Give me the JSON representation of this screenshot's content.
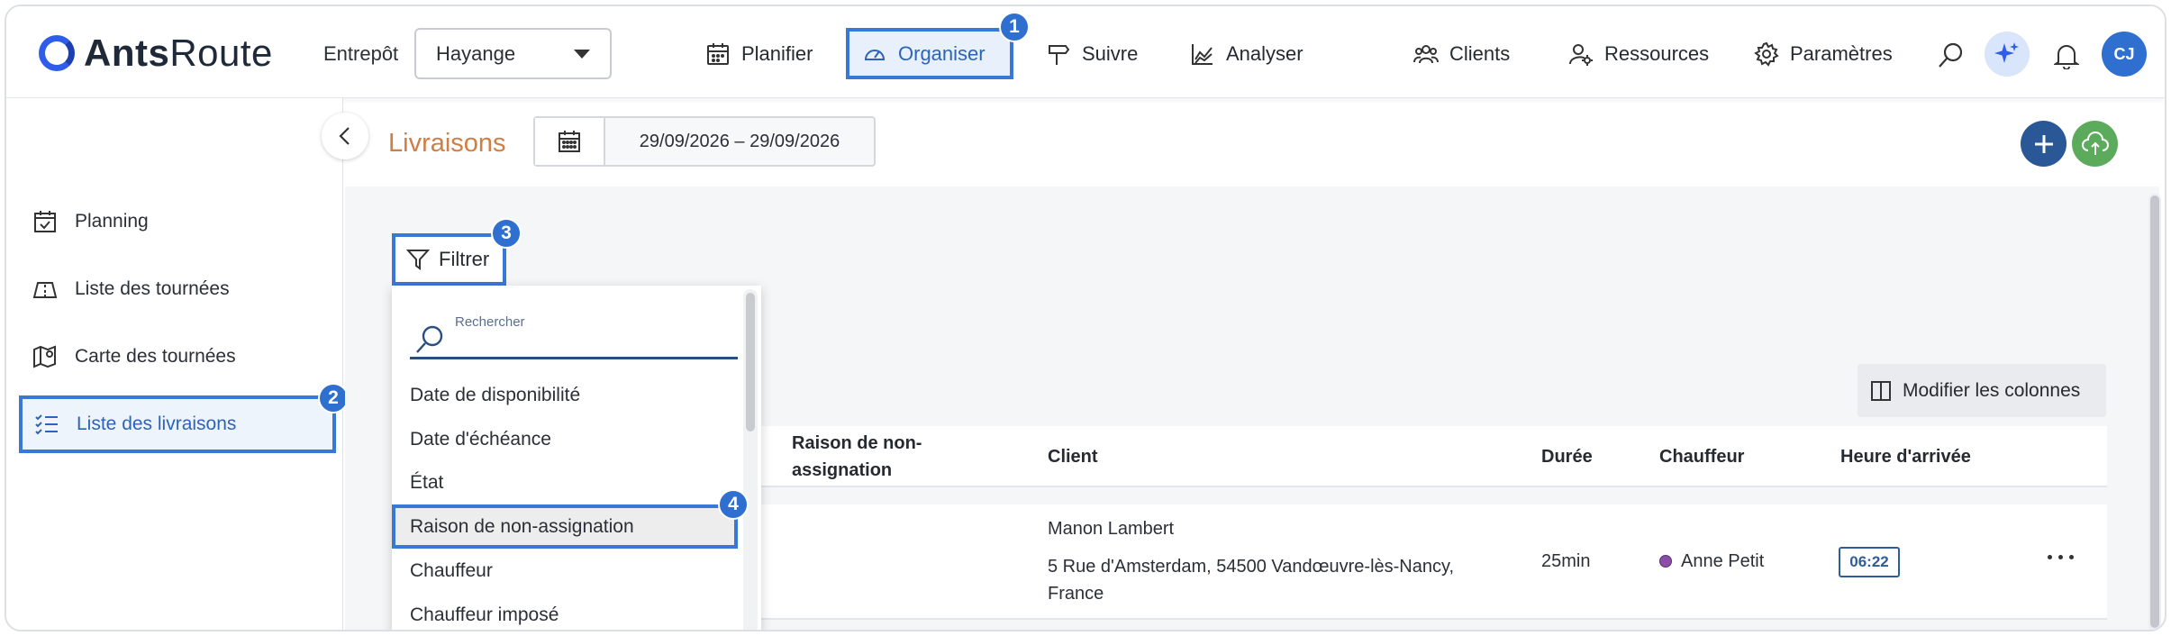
{
  "app": {
    "logo_bold": "Ants",
    "logo_light": "Route"
  },
  "topbar": {
    "warehouse_label": "Entrepôt",
    "warehouse_value": "Hayange",
    "nav": [
      {
        "label": "Planifier",
        "icon": "calendar-icon"
      },
      {
        "label": "Organiser",
        "icon": "gauge-icon",
        "active": true,
        "badge": "1"
      },
      {
        "label": "Suivre",
        "icon": "signpost-icon"
      },
      {
        "label": "Analyser",
        "icon": "chart-icon"
      },
      {
        "label": "Clients",
        "icon": "users-icon"
      },
      {
        "label": "Ressources",
        "icon": "user-gear-icon"
      },
      {
        "label": "Paramètres",
        "icon": "gear-icon"
      }
    ],
    "avatar_initials": "CJ"
  },
  "sidebar": {
    "items": [
      {
        "label": "Planning",
        "icon": "calendar-check-icon"
      },
      {
        "label": "Liste des tournées",
        "icon": "route-list-icon"
      },
      {
        "label": "Carte des tournées",
        "icon": "map-pin-icon"
      },
      {
        "label": "Liste des livraisons",
        "icon": "checklist-icon",
        "active": true,
        "badge": "2"
      }
    ]
  },
  "page": {
    "title": "Livraisons",
    "date_range": "29/09/2026 – 29/09/2026"
  },
  "filter": {
    "label": "Filtrer",
    "badge": "3",
    "search_placeholder": "Rechercher",
    "options": [
      "Date de disponibilité",
      "Date d'échéance",
      "État",
      "Raison de non-assignation",
      "Chauffeur",
      "Chauffeur imposé"
    ],
    "highlighted_badge": "4"
  },
  "table": {
    "modify_columns_label": "Modifier les colonnes",
    "headers": {
      "reason_line1": "Raison de non-",
      "reason_line2": "assignation",
      "client": "Client",
      "duration": "Durée",
      "driver": "Chauffeur",
      "arrival": "Heure d'arrivée"
    },
    "rows": [
      {
        "client_name": "Manon Lambert",
        "address_line1": "5 Rue d'Amsterdam, 54500 Vandœuvre-lès-Nancy,",
        "address_line2": "France",
        "duration": "25min",
        "driver": "Anne Petit",
        "driver_color": "#8b4ea8",
        "arrival": "06:22"
      }
    ]
  },
  "colors": {
    "accent": "#3a78d8",
    "title": "#cf7e45",
    "fab_blue": "#2a5796",
    "fab_green": "#5cab5c"
  }
}
